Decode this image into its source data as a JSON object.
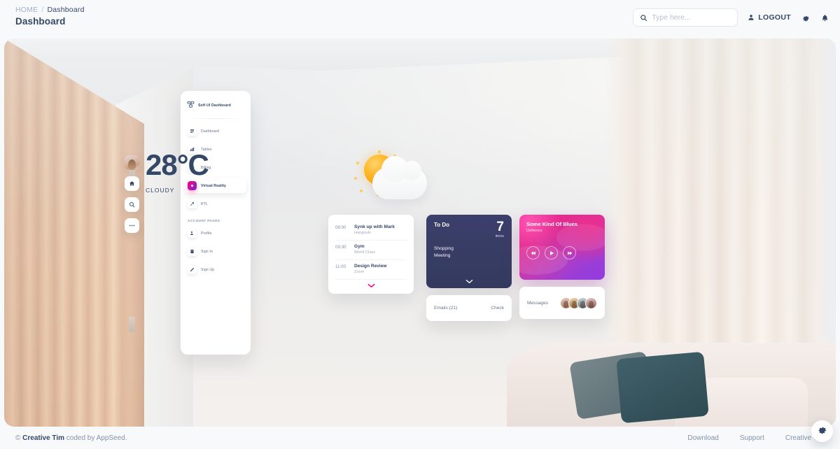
{
  "header": {
    "breadcrumb": {
      "home": "HOME",
      "separator": "/",
      "current": "Dashboard"
    },
    "page_title": "Dashboard",
    "search": {
      "placeholder": "Type here...",
      "value": "",
      "icon": "search-icon"
    },
    "logout_label": "LOGOUT",
    "icons": {
      "user": "user-icon",
      "settings": "gear-icon",
      "notifications": "bell-icon"
    }
  },
  "vr_menu": {
    "brand": "Soft UI Dashboard",
    "brand_icon": "soft-ui-logo-icon",
    "items": [
      {
        "label": "Dashboard",
        "icon": "dashboard-icon",
        "active": false
      },
      {
        "label": "Tables",
        "icon": "tables-icon",
        "active": false
      },
      {
        "label": "Billing",
        "icon": "billing-icon",
        "active": false
      },
      {
        "label": "Virtual Reality",
        "icon": "vr-icon",
        "active": true
      },
      {
        "label": "RTL",
        "icon": "rtl-icon",
        "active": false
      }
    ],
    "section_label": "ACCOUNT PAGES",
    "account_items": [
      {
        "label": "Profile",
        "icon": "profile-icon"
      },
      {
        "label": "Sign In",
        "icon": "signin-icon"
      },
      {
        "label": "Sign Up",
        "icon": "signup-icon"
      }
    ]
  },
  "left_rail": {
    "avatar": "user-avatar",
    "buttons": [
      {
        "icon": "home-icon"
      },
      {
        "icon": "search-icon"
      },
      {
        "icon": "more-icon"
      }
    ]
  },
  "weather": {
    "temperature": "28°C",
    "condition": "CLOUDY",
    "icon": "sun-behind-cloud-icon"
  },
  "schedule": {
    "events": [
      {
        "time": "08:00",
        "title": "Synk up with Mark",
        "subtitle": "Hangouts"
      },
      {
        "time": "09:30",
        "title": "Gym",
        "subtitle": "World Class"
      },
      {
        "time": "11:00",
        "title": "Design Review",
        "subtitle": "Zoom"
      }
    ],
    "expand_icon": "chevron-down-icon"
  },
  "todo": {
    "title": "To Do",
    "count": "7",
    "count_label": "items",
    "items": [
      "Shopping",
      "Meeting"
    ],
    "expand_icon": "chevron-down-icon"
  },
  "emails": {
    "label": "Emails (21)",
    "action": "Check"
  },
  "music": {
    "title": "Some Kind Of Blues",
    "artist": "Deftones",
    "controls": [
      {
        "icon": "previous-icon"
      },
      {
        "icon": "play-icon"
      },
      {
        "icon": "next-icon"
      }
    ]
  },
  "messages": {
    "label": "Messages",
    "avatar_count": 4
  },
  "footer": {
    "copyright_prefix": "© ",
    "brand": "Creative Tim",
    "copyright_suffix": " coded by AppSeed.",
    "links": [
      "Download",
      "Support",
      "Creative Tim"
    ]
  },
  "fab": {
    "icon": "gear-icon"
  },
  "colors": {
    "accent_pink": "#ff0080",
    "accent_purple": "#7928ca",
    "text_dark": "#344767",
    "text_muted": "#8392ab",
    "todo_bg": "#3b3f6b"
  }
}
